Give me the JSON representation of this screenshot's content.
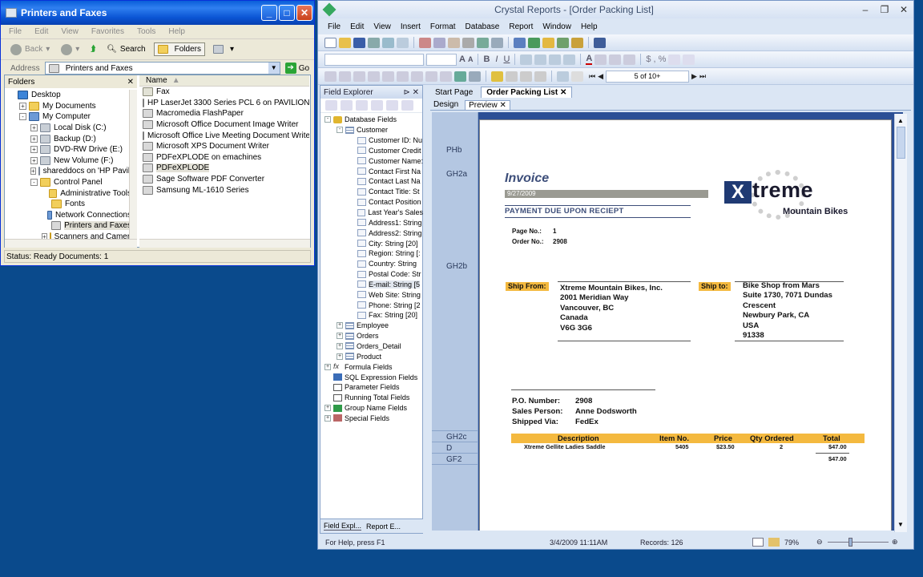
{
  "explorer": {
    "title": "Printers and Faxes",
    "menu": [
      "File",
      "Edit",
      "View",
      "Favorites",
      "Tools",
      "Help"
    ],
    "toolbar": {
      "back": "Back",
      "search": "Search",
      "folders": "Folders"
    },
    "address": {
      "label": "Address",
      "value": "Printers and Faxes",
      "go": "Go"
    },
    "folders_label": "Folders",
    "tree": [
      {
        "label": "Desktop",
        "icon": "desktop-icon",
        "indent": 0,
        "expander": ""
      },
      {
        "label": "My Documents",
        "icon": "folder-icon",
        "indent": 1,
        "expander": "+"
      },
      {
        "label": "My Computer",
        "icon": "computer-icon",
        "indent": 1,
        "expander": "-"
      },
      {
        "label": "Local Disk (C:)",
        "icon": "drive-icon",
        "indent": 2,
        "expander": "+"
      },
      {
        "label": "Backup (D:)",
        "icon": "drive-icon",
        "indent": 2,
        "expander": "+"
      },
      {
        "label": "DVD-RW Drive (E:)",
        "icon": "drive-icon",
        "indent": 2,
        "expander": "+"
      },
      {
        "label": "New Volume (F:)",
        "icon": "drive-icon",
        "indent": 2,
        "expander": "+"
      },
      {
        "label": "shareddocs on 'HP Pavilion",
        "icon": "drive-icon",
        "indent": 2,
        "expander": "+"
      },
      {
        "label": "Control Panel",
        "icon": "folder-icon",
        "indent": 2,
        "expander": "-"
      },
      {
        "label": "Administrative Tools",
        "icon": "folder-icon",
        "indent": 3,
        "expander": ""
      },
      {
        "label": "Fonts",
        "icon": "folder-icon",
        "indent": 3,
        "expander": ""
      },
      {
        "label": "Network Connections",
        "icon": "computer-icon",
        "indent": 3,
        "expander": ""
      },
      {
        "label": "Printers and Faxes",
        "icon": "printer-icon",
        "indent": 3,
        "expander": "",
        "selected": true
      },
      {
        "label": "Scanners and Cameras",
        "icon": "folder-icon",
        "indent": 3,
        "expander": "+"
      }
    ],
    "name_header": "Name",
    "files": [
      {
        "label": "Fax",
        "icon": "fax-icon"
      },
      {
        "label": "HP LaserJet 3300 Series PCL 6 on PAVILION",
        "icon": "printer-icon"
      },
      {
        "label": "Macromedia FlashPaper",
        "icon": "printer-icon"
      },
      {
        "label": "Microsoft Office Document Image Writer",
        "icon": "printer-icon"
      },
      {
        "label": "Microsoft Office Live Meeting Document Writer",
        "icon": "printer-icon"
      },
      {
        "label": "Microsoft XPS Document Writer",
        "icon": "printer-icon"
      },
      {
        "label": "PDFeXPLODE on emachines",
        "icon": "printer-icon"
      },
      {
        "label": "PDFeXPLODE",
        "icon": "printer-icon",
        "selected": true
      },
      {
        "label": "Sage Software PDF Converter",
        "icon": "printer-icon"
      },
      {
        "label": "Samsung ML-1610 Series",
        "icon": "printer-icon"
      }
    ],
    "status": "Status: Ready Documents: 1"
  },
  "crystal": {
    "title": "Crystal Reports - [Order Packing List]",
    "menu": [
      "File",
      "Edit",
      "View",
      "Insert",
      "Format",
      "Database",
      "Report",
      "Window",
      "Help"
    ],
    "page_nav": "5 of 10+",
    "field_explorer": {
      "title": "Field Explorer",
      "tree": [
        {
          "label": "Database Fields",
          "icon": "database-icon",
          "indent": 0,
          "expander": "-"
        },
        {
          "label": "Customer",
          "icon": "table-icon",
          "indent": 1,
          "expander": "-"
        },
        {
          "label": "Customer ID: Nu",
          "icon": "field-icon",
          "indent": 2,
          "expander": ""
        },
        {
          "label": "Customer Credit",
          "icon": "field-icon",
          "indent": 2,
          "expander": ""
        },
        {
          "label": "Customer Name:",
          "icon": "field-icon",
          "indent": 2,
          "expander": ""
        },
        {
          "label": "Contact First Na",
          "icon": "field-icon",
          "indent": 2,
          "expander": ""
        },
        {
          "label": "Contact Last Na",
          "icon": "field-icon",
          "indent": 2,
          "expander": ""
        },
        {
          "label": "Contact Title: St",
          "icon": "field-icon",
          "indent": 2,
          "expander": ""
        },
        {
          "label": "Contact Position",
          "icon": "field-icon",
          "indent": 2,
          "expander": ""
        },
        {
          "label": "Last Year's Sales",
          "icon": "field-icon",
          "indent": 2,
          "expander": ""
        },
        {
          "label": "Address1: String",
          "icon": "field-icon",
          "indent": 2,
          "expander": ""
        },
        {
          "label": "Address2: String",
          "icon": "field-icon",
          "indent": 2,
          "expander": ""
        },
        {
          "label": "City: String [20]",
          "icon": "field-icon",
          "indent": 2,
          "expander": ""
        },
        {
          "label": "Region: String [:",
          "icon": "field-icon",
          "indent": 2,
          "expander": ""
        },
        {
          "label": "Country: String",
          "icon": "field-icon",
          "indent": 2,
          "expander": ""
        },
        {
          "label": "Postal Code: Str",
          "icon": "field-icon",
          "indent": 2,
          "expander": ""
        },
        {
          "label": "E-mail: String [5",
          "icon": "field-icon",
          "indent": 2,
          "expander": "",
          "selected": true
        },
        {
          "label": "Web Site: String",
          "icon": "field-icon",
          "indent": 2,
          "expander": ""
        },
        {
          "label": "Phone: String [2",
          "icon": "field-icon",
          "indent": 2,
          "expander": ""
        },
        {
          "label": "Fax: String [20]",
          "icon": "field-icon",
          "indent": 2,
          "expander": ""
        },
        {
          "label": "Employee",
          "icon": "table-icon",
          "indent": 1,
          "expander": "+"
        },
        {
          "label": "Orders",
          "icon": "table-icon",
          "indent": 1,
          "expander": "+"
        },
        {
          "label": "Orders_Detail",
          "icon": "table-icon",
          "indent": 1,
          "expander": "+"
        },
        {
          "label": "Product",
          "icon": "table-icon",
          "indent": 1,
          "expander": "+"
        },
        {
          "label": "Formula Fields",
          "icon": "formula-icon",
          "indent": 0,
          "expander": "+"
        },
        {
          "label": "SQL Expression Fields",
          "icon": "sql-icon",
          "indent": 0,
          "expander": ""
        },
        {
          "label": "Parameter Fields",
          "icon": "parameter-icon",
          "indent": 0,
          "expander": ""
        },
        {
          "label": "Running Total Fields",
          "icon": "running-total-icon",
          "indent": 0,
          "expander": ""
        },
        {
          "label": "Group Name Fields",
          "icon": "group-icon",
          "indent": 0,
          "expander": "+"
        },
        {
          "label": "Special Fields",
          "icon": "special-icon",
          "indent": 0,
          "expander": "+"
        }
      ],
      "bottom_tabs": [
        "Field Expl...",
        "Report E..."
      ]
    },
    "doc_tabs": [
      "Start Page",
      "Order Packing List"
    ],
    "view_tabs": [
      "Design",
      "Preview"
    ],
    "sections": [
      "PHb",
      "GH2a",
      "GH2b",
      "GH2c",
      "D",
      "GF2"
    ],
    "report": {
      "title": "Invoice",
      "date": "9/27/2009",
      "payment_note": "PAYMENT DUE UPON RECIEPT",
      "page_no_label": "Page No.:",
      "page_no": "1",
      "order_no_label": "Order No.:",
      "order_no": "2908",
      "logo_x": "X",
      "logo_text": "treme",
      "logo_sub": "Mountain Bikes",
      "ship_from_label": "Ship From:",
      "ship_from": [
        "Xtreme Mountain Bikes, Inc.",
        "2001 Meridian Way",
        "Vancouver, BC",
        "Canada",
        "V6G 3G6"
      ],
      "ship_to_label": "Ship to:",
      "ship_to": [
        "Bike Shop from Mars",
        "Suite 1730, 7071 Dundas",
        "Crescent",
        "Newbury Park, CA",
        "USA",
        "91338"
      ],
      "po_label": "P.O. Number:",
      "po": "2908",
      "sales_label": "Sales Person:",
      "sales": "Anne Dodsworth",
      "via_label": "Shipped Via:",
      "via": "FedEx",
      "columns": [
        "Description",
        "Item No.",
        "Price",
        "Qty Ordered",
        "Total"
      ],
      "rows": [
        {
          "description": "Xtreme Gellite  Ladies Saddle",
          "item": "5405",
          "price": "$23.50",
          "qty": "2",
          "total": "$47.00"
        }
      ],
      "grand_total": "$47.00"
    },
    "status": {
      "help": "For Help, press F1",
      "datetime": "3/4/2009  11:11AM",
      "records": "Records:  126",
      "zoom": "79%"
    }
  }
}
